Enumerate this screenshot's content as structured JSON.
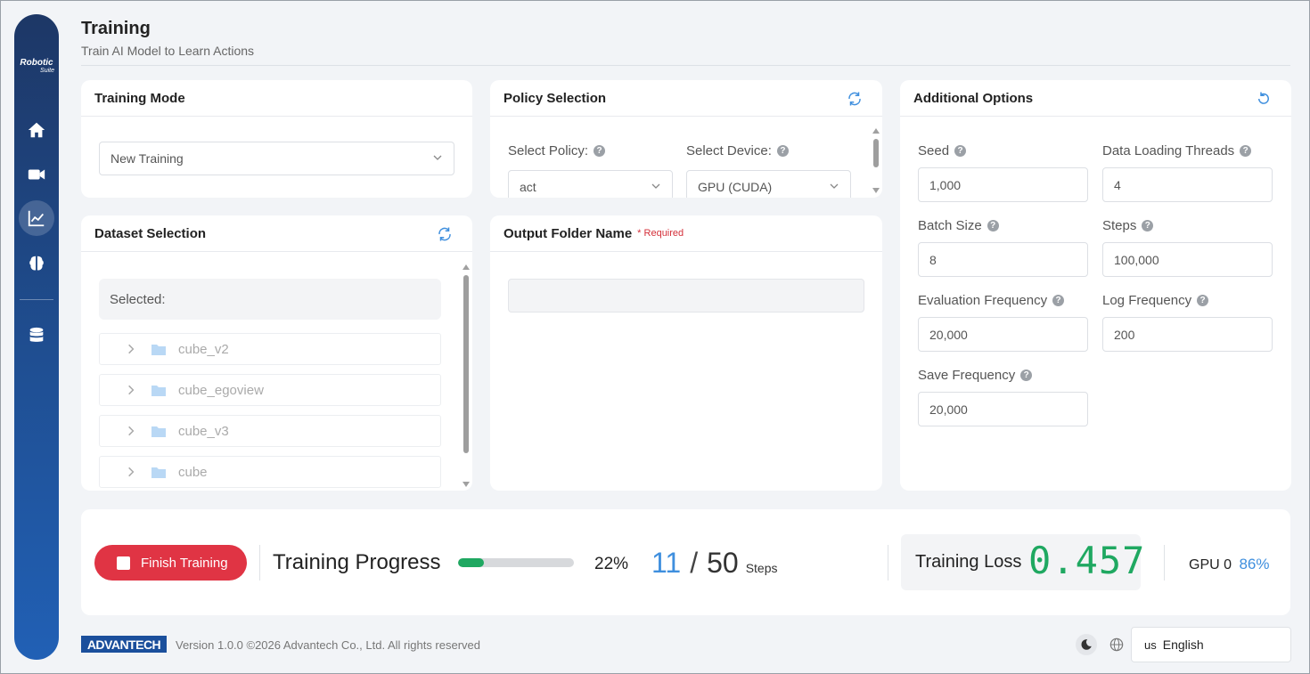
{
  "header": {
    "title": "Training",
    "subtitle": "Train AI Model to Learn Actions"
  },
  "sidebar": {
    "logo": {
      "main": "Robotic",
      "sub": "Suite"
    },
    "items": [
      {
        "icon": "home-icon",
        "active": false
      },
      {
        "icon": "video-camera-icon",
        "active": false
      },
      {
        "icon": "chart-line-icon",
        "active": true
      },
      {
        "icon": "brain-icon",
        "active": false
      },
      {
        "icon": "database-icon",
        "active": false
      }
    ]
  },
  "training_mode": {
    "title": "Training Mode",
    "value": "New Training"
  },
  "policy": {
    "title": "Policy Selection",
    "policy_label": "Select Policy:",
    "policy_value": "act",
    "device_label": "Select Device:",
    "device_value": "GPU (CUDA)"
  },
  "options": {
    "title": "Additional Options",
    "fields": {
      "seed": {
        "label": "Seed",
        "value": "1,000"
      },
      "threads": {
        "label": "Data Loading Threads",
        "value": "4"
      },
      "batch": {
        "label": "Batch Size",
        "value": "8"
      },
      "steps": {
        "label": "Steps",
        "value": "100,000"
      },
      "eval": {
        "label": "Evaluation Frequency",
        "value": "20,000"
      },
      "log": {
        "label": "Log Frequency",
        "value": "200"
      },
      "save": {
        "label": "Save Frequency",
        "value": "20,000"
      }
    }
  },
  "dataset": {
    "title": "Dataset Selection",
    "selected_label": "Selected:",
    "items": [
      "cube_v2",
      "cube_egoview",
      "cube_v3",
      "cube"
    ]
  },
  "output": {
    "title": "Output Folder Name",
    "required": "* Required",
    "value": ""
  },
  "progress": {
    "finish_label": "Finish Training",
    "label": "Training Progress",
    "percent": 22,
    "percent_text": "22%",
    "current": "11",
    "total": "50",
    "unit": "Steps",
    "loss_label": "Training Loss",
    "loss_value": "0.457",
    "gpu_label": "GPU 0",
    "gpu_value": "86%"
  },
  "footer": {
    "brand": "ADVANTECH",
    "version": "Version 1.0.0 ©2026 Advantech Co., Ltd. All rights reserved",
    "lang_flag": "us",
    "lang": "English"
  },
  "colors": {
    "accent": "#3f8fde",
    "success": "#1fa861",
    "danger": "#e03444",
    "sidebar": "#1f4f93"
  }
}
